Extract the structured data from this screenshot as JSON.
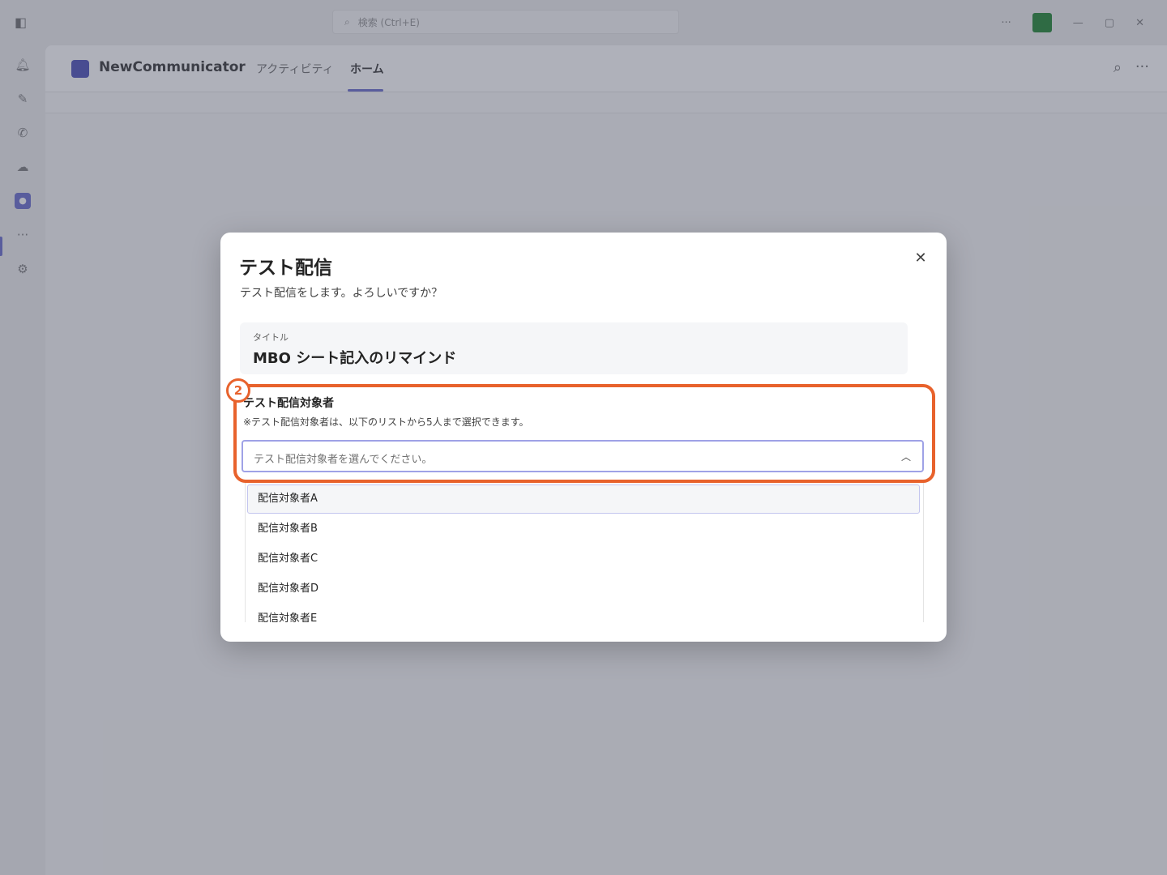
{
  "titlebar": {
    "search_placeholder": "検索 (Ctrl+E)",
    "more_label": "···"
  },
  "app": {
    "name": "NewCommunicator",
    "tabs": [
      {
        "label": "アクティビティ",
        "active": false
      },
      {
        "label": "ホーム",
        "active": true
      }
    ]
  },
  "rail": {
    "items": [
      "activity-icon",
      "chat-icon",
      "calls-icon",
      "cloud-icon",
      "app-icon",
      "more-icon",
      "settings-icon"
    ]
  },
  "dialog": {
    "title": "テスト配信",
    "description": "テスト配信をします。よろしいですか？",
    "title_field": {
      "label": "タイトル",
      "value": "MBO シート記入のリマインド"
    },
    "recipients": {
      "label": "テスト配信対象者",
      "note": "※テスト配信対象者は、以下のリストから5人まで選択できます。",
      "placeholder": "テスト配信対象者を選んでください。",
      "expanded": true,
      "options": [
        "配信対象者A",
        "配信対象者B",
        "配信対象者C",
        "配信対象者D",
        "配信対象者E"
      ],
      "highlighted_index": 0
    }
  },
  "annotation": {
    "number": "2",
    "color": "#e8622c"
  },
  "colors": {
    "brand": "#5b5fc7",
    "avatar": "#0a7a1e"
  }
}
